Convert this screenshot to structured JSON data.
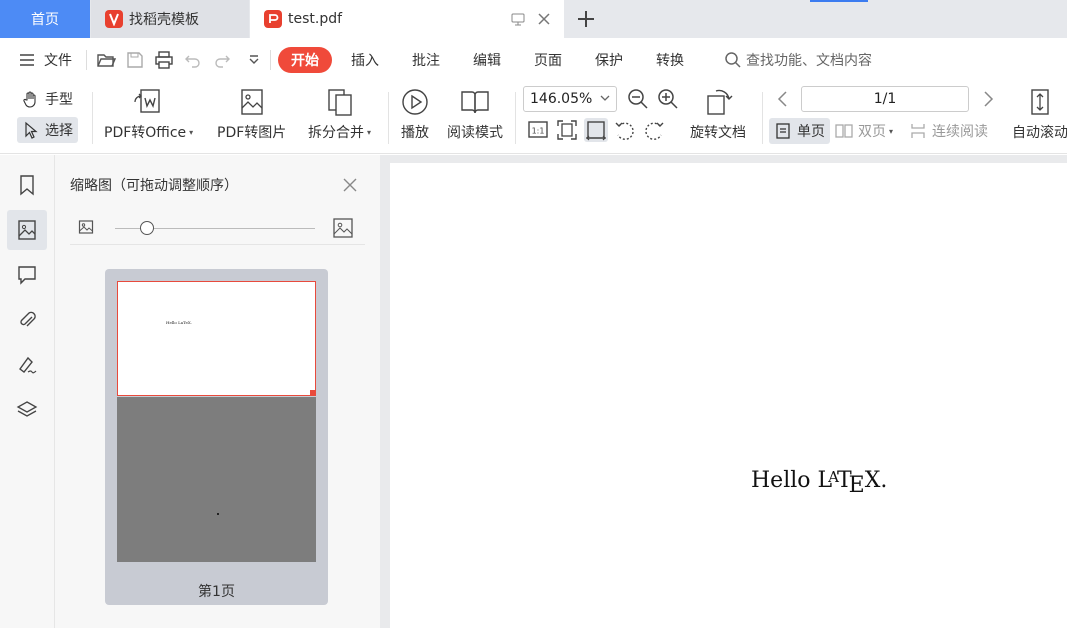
{
  "tabs": {
    "home": "首页",
    "template": "找稻壳模板",
    "pdf": "test.pdf"
  },
  "menu": {
    "file": "文件",
    "items": [
      "开始",
      "插入",
      "批注",
      "编辑",
      "页面",
      "保护",
      "转换"
    ],
    "search_placeholder": "查找功能、文档内容"
  },
  "ribbon": {
    "hand": "手型",
    "select": "选择",
    "pdf_to_office": "PDF转Office",
    "pdf_to_image": "PDF转图片",
    "split_merge": "拆分合并",
    "play": "播放",
    "read_mode": "阅读模式",
    "zoom": "146.05%",
    "rotate": "旋转文档",
    "page_indicator": "1/1",
    "single_page": "单页",
    "double_page": "双页",
    "continuous": "连续阅读",
    "auto_scroll": "自动滚动"
  },
  "thumbnail_panel": {
    "title": "缩略图（可拖动调整顺序）",
    "page_label": "第1页",
    "mini_text": "Hello LaTeX."
  },
  "document": {
    "text_hello": "Hello",
    "text_latex_l": "L",
    "text_latex_a": "A",
    "text_latex_t": "T",
    "text_latex_e": "E",
    "text_latex_x": "X."
  },
  "colors": {
    "accent_blue": "#4d8bf5",
    "start_red": "#f04a3a"
  }
}
